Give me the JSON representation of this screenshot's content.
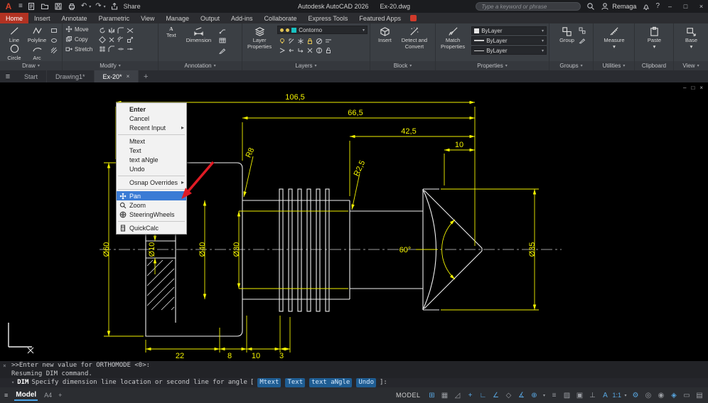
{
  "titlebar": {
    "app_title": "Autodesk AutoCAD 2026",
    "doc_title": "Ex-20.dwg",
    "share_label": "Share",
    "search_placeholder": "Type a keyword or phrase",
    "user_name": "Remaga"
  },
  "icons": {
    "logo": "A",
    "hamburger": "≡",
    "caret": "▾",
    "submenu_arrow": "▸",
    "minimize": "–",
    "maximize": "□",
    "close": "×",
    "plus": "+",
    "undo": "↶",
    "redo": "↷",
    "help": "?",
    "text_tool": "A"
  },
  "ribbon_tabs": {
    "items": [
      "Home",
      "Insert",
      "Annotate",
      "Parametric",
      "View",
      "Manage",
      "Output",
      "Add-ins",
      "Collaborate",
      "Express Tools",
      "Featured Apps"
    ]
  },
  "ribbon": {
    "draw": {
      "title": "Draw",
      "line": "Line",
      "polyline": "Polyline",
      "circle": "Circle",
      "arc": "Arc"
    },
    "modify": {
      "title": "Modify",
      "move": "Move",
      "copy": "Copy",
      "stretch": "Stretch"
    },
    "annotation": {
      "title": "Annotation",
      "text": "Text",
      "dimension": "Dimension"
    },
    "layers": {
      "title": "Layers",
      "btn_l1": "Layer",
      "btn_l2": "Properties",
      "current_layer": "Contorno"
    },
    "block": {
      "title": "Block",
      "insert": "Insert",
      "detect_l1": "Detect and",
      "detect_l2": "Convert"
    },
    "properties": {
      "title": "Properties",
      "match_l1": "Match",
      "match_l2": "Properties",
      "color": "ByLayer",
      "lineweight": "ByLayer",
      "linetype": "ByLayer"
    },
    "groups": {
      "title": "Groups",
      "group": "Group"
    },
    "utilities": {
      "title": "Utilities",
      "measure": "Measure"
    },
    "clipboard": {
      "title": "Clipboard",
      "paste": "Paste"
    },
    "view": {
      "title": "View",
      "base": "Base"
    }
  },
  "file_tabs": {
    "start": "Start",
    "drawing1": "Drawing1*",
    "active": "Ex-20*"
  },
  "context_menu": {
    "enter": "Enter",
    "cancel": "Cancel",
    "recent_input": "Recent Input",
    "mtext": "Mtext",
    "text": "Text",
    "text_angle": "text aNgle",
    "undo": "Undo",
    "osnap_overrides": "Osnap Overrides",
    "pan": "Pan",
    "zoom": "Zoom",
    "steering_wheels": "SteeringWheels",
    "quickcalc": "QuickCalc"
  },
  "drawing": {
    "dim_total": "106,5",
    "dim_66": "66,5",
    "dim_42": "42,5",
    "dim_10": "10",
    "r8": "R8",
    "r2_5": "R2,5",
    "dia60": "Ø60",
    "dia10": "Ø10",
    "dia40": "Ø40",
    "dia30": "Ø30",
    "angle60": "60°",
    "dia35": "Ø35",
    "b22": "22",
    "b8": "8",
    "b10": "10",
    "b3": "3"
  },
  "command_line": {
    "line1": ">>Enter new value for ORTHOMODE <0>:",
    "line2": "Resuming DIM command.",
    "prompt_cmd": "DIM",
    "prompt_text": "Specify dimension line location or second line for angle",
    "bracket_open": "[",
    "opt_mtext": "Mtext",
    "opt_text": "Text",
    "opt_angle": "text aNgle",
    "opt_undo": "Undo",
    "bracket_close": "]:"
  },
  "status_bar": {
    "model_tab": "Model",
    "paper": "A4",
    "mode": "MODEL",
    "scale": "1:1",
    "icons": [
      {
        "name": "grid-icon",
        "glyph": "⊞"
      },
      {
        "name": "snap-mode-icon",
        "glyph": "▦"
      },
      {
        "name": "infer-constraints-icon",
        "glyph": "◿"
      },
      {
        "name": "dynamic-input-icon",
        "glyph": "+"
      },
      {
        "name": "ortho-mode-icon",
        "glyph": "∟"
      },
      {
        "name": "polar-tracking-icon",
        "glyph": "∠"
      },
      {
        "name": "isodraft-icon",
        "glyph": "◇"
      },
      {
        "name": "osnap-tracking-icon",
        "glyph": "∡"
      },
      {
        "name": "object-snap-icon",
        "glyph": "⊕"
      },
      {
        "name": "lineweight-icon",
        "glyph": "≡"
      },
      {
        "name": "transparency-icon",
        "glyph": "▨"
      },
      {
        "name": "selection-cycling-icon",
        "glyph": "▣"
      },
      {
        "name": "dynamic-ucs-icon",
        "glyph": "⊥"
      },
      {
        "name": "annotation-visibility-icon",
        "glyph": "A"
      },
      {
        "name": "workspace-icon",
        "glyph": "⚙"
      },
      {
        "name": "annotation-monitor-icon",
        "glyph": "◎"
      },
      {
        "name": "isolate-objects-icon",
        "glyph": "◉"
      },
      {
        "name": "graphics-performance-icon",
        "glyph": "◈"
      },
      {
        "name": "clean-screen-icon",
        "glyph": "▭"
      },
      {
        "name": "customize-icon",
        "glyph": "▤"
      }
    ]
  }
}
